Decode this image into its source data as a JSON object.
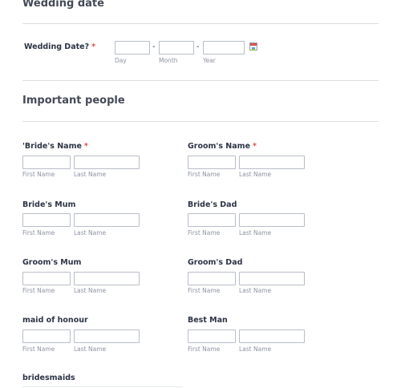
{
  "wedding_section": {
    "title": "Wedding date",
    "date_label": "Wedding Date?",
    "required_mark": "*",
    "separator": "-",
    "day_sub": "Day",
    "month_sub": "Month",
    "year_sub": "Year",
    "calendar_icon": "calendar-icon"
  },
  "people_section": {
    "title": "Important people",
    "first_sub": "First Name",
    "last_sub": "Last Name",
    "required_mark": "*",
    "fields": {
      "bride": {
        "label": "'Bride's Name",
        "required": true
      },
      "groom": {
        "label": "Groom's Name",
        "required": true
      },
      "brides_mum": {
        "label": "Bride's Mum"
      },
      "brides_dad": {
        "label": "Bride's Dad"
      },
      "grooms_mum": {
        "label": "Groom's Mum"
      },
      "grooms_dad": {
        "label": "Groom's Dad"
      },
      "maid": {
        "label": "maid of honour"
      },
      "best_man": {
        "label": "Best Man"
      },
      "bridesmaids": {
        "label": "bridesmaids"
      }
    }
  }
}
